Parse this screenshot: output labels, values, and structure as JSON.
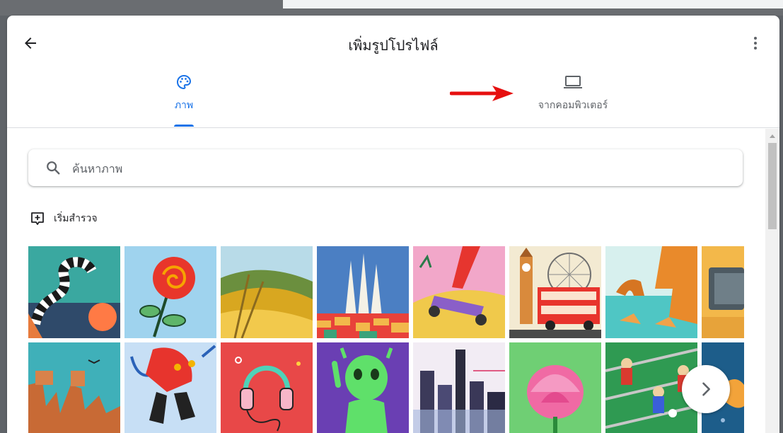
{
  "dialog": {
    "title": "เพิ่มรูปโปรไฟล์",
    "back_icon": "arrow-left-icon",
    "menu_icon": "more-vert-icon"
  },
  "tabs": [
    {
      "label": "ภาพ",
      "icon": "palette-icon",
      "selected": true
    },
    {
      "label": "จากคอมพิวเตอร์",
      "icon": "laptop-icon",
      "selected": false
    }
  ],
  "annotation": {
    "icon": "red-arrow-icon",
    "color": "#e60f0f"
  },
  "search": {
    "placeholder": "ค้นหาภาพ",
    "value": "",
    "icon": "search-icon"
  },
  "explore": {
    "label": "เริ่มสำรวจ",
    "icon": "explore-add-icon"
  },
  "gallery": {
    "items": [
      "snake-illustration",
      "rose-illustration",
      "wheat-field-illustration",
      "sagrada-familia-illustration",
      "hoverboard-illustration",
      "london-big-ben-bus-illustration",
      "coastal-cliffs-illustration",
      "retro-tv-illustration",
      "rock-formations-illustration",
      "electric-plug-illustration",
      "headphones-illustration",
      "green-alien-illustration",
      "city-skyline-illustration",
      "lotus-flower-illustration",
      "foosball-illustration",
      "fish-illustration"
    ],
    "next_icon": "chevron-right-icon"
  },
  "colors": {
    "accent": "#1a73e8",
    "text": "#202124",
    "muted": "#5f6368"
  }
}
